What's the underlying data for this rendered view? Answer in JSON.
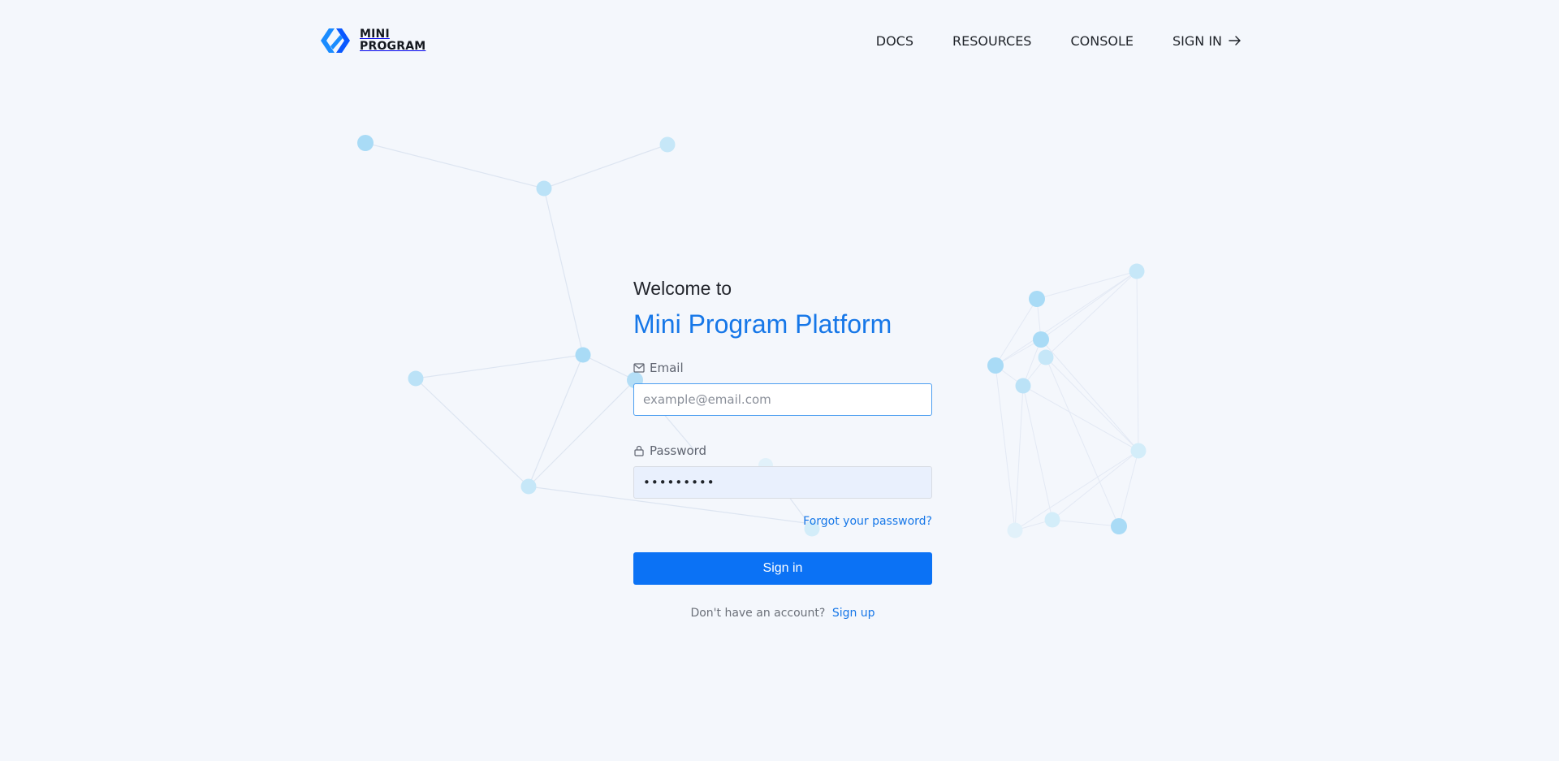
{
  "brand": {
    "line1": "MINI",
    "line2": "PROGRAM",
    "color_primary": "#1a8cff",
    "color_secondary": "#0a58ff"
  },
  "nav": {
    "items": [
      {
        "label": "DOCS"
      },
      {
        "label": "RESOURCES"
      },
      {
        "label": "CONSOLE"
      },
      {
        "label": "SIGN IN",
        "icon": "arrow-right-icon"
      }
    ]
  },
  "login": {
    "welcome": "Welcome to",
    "platform": "Mini Program Platform",
    "email_label": "Email",
    "email_icon": "envelope-icon",
    "email_placeholder": "example@email.com",
    "email_value": "",
    "password_label": "Password",
    "password_icon": "lock-icon",
    "password_value": "•••••••••",
    "forgot_link": "Forgot your password?",
    "signin_button": "Sign in",
    "no_account_text": "Don't have an account?",
    "signup_link": "Sign up"
  },
  "colors": {
    "accent": "#1677e8",
    "button": "#0b72f5",
    "background": "#f4f7fc",
    "node": "#a9dbf6"
  }
}
